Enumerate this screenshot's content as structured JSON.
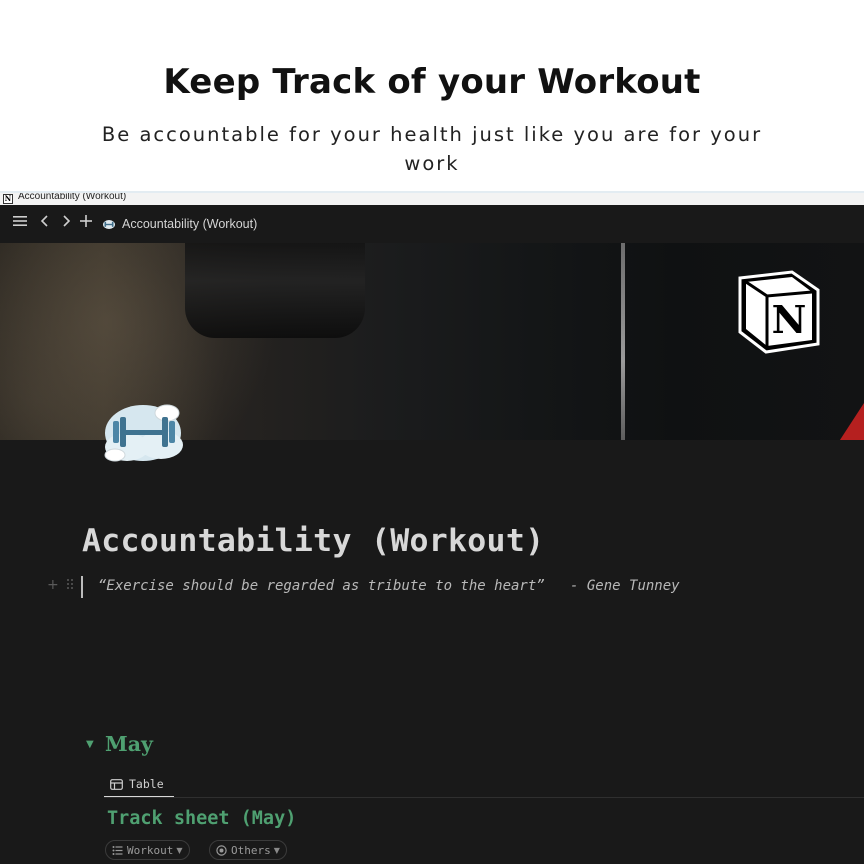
{
  "promo": {
    "title": "Keep Track of your Workout",
    "subtitle": "Be accountable for your health just like you are for your work"
  },
  "os_window": {
    "title": "Accountability (Workout)"
  },
  "topbar": {
    "menu_icon": "hamburger-icon",
    "back_icon": "chevron-left-icon",
    "forward_icon": "chevron-right-icon",
    "new_icon": "plus-icon",
    "page_label": "Accountability (Workout)"
  },
  "page": {
    "title": "Accountability (Workout)",
    "quote": "“Exercise should be regarded as tribute to the heart”   - Gene Tunney",
    "toggle_heading": "May",
    "views": [
      {
        "label": "Table",
        "icon": "table-icon",
        "active": true
      }
    ],
    "database_title": "Track sheet (May)",
    "filters": [
      {
        "label": "Workout",
        "icon": "list-icon"
      },
      {
        "label": "Others",
        "icon": "circle-icon"
      }
    ]
  },
  "colors": {
    "accent_green": "#4fa071",
    "app_background": "#191919",
    "cover_red": "#b5201f"
  }
}
